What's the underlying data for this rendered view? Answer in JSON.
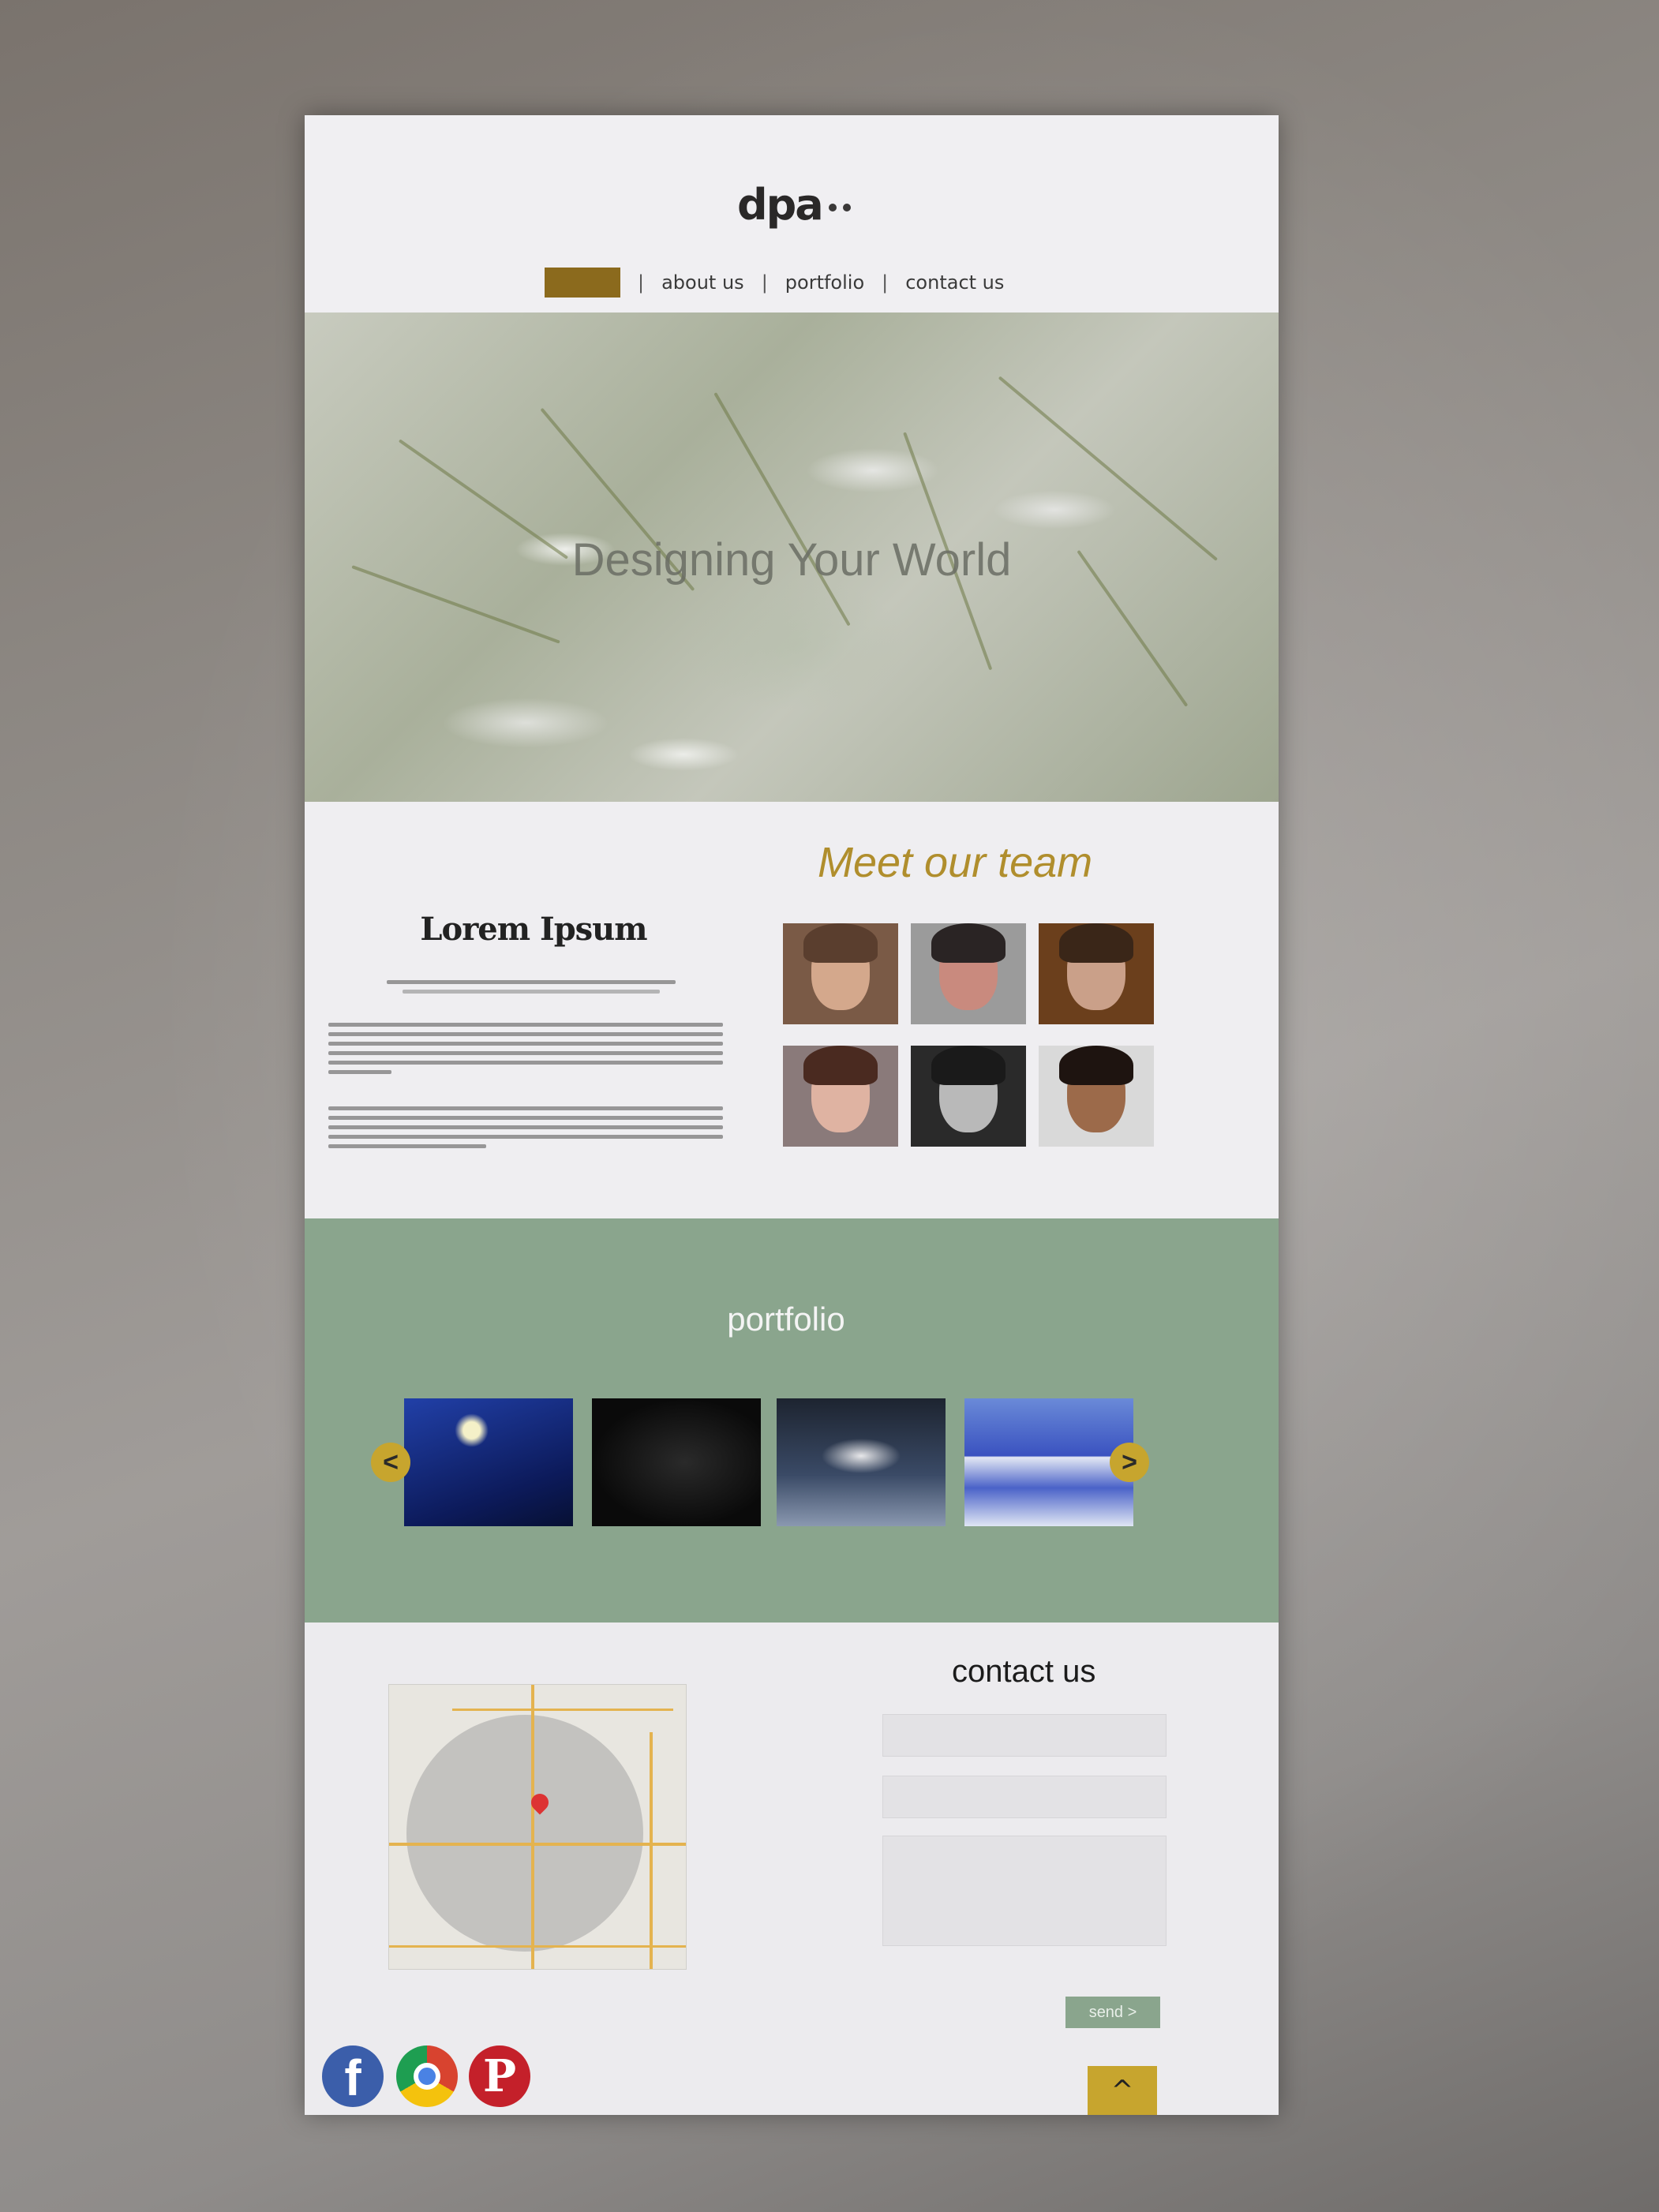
{
  "header": {
    "logo": "dpa",
    "nav": [
      {
        "label": ""
      },
      {
        "label": "about us"
      },
      {
        "label": "portfolio"
      },
      {
        "label": "contact us"
      }
    ]
  },
  "hero": {
    "title": "Designing Your World"
  },
  "team": {
    "heading": "Meet our team",
    "lorem_title": "Lorem Ipsum"
  },
  "portfolio": {
    "heading": "portfolio",
    "prev_label": "<",
    "next_label": ">"
  },
  "contact": {
    "heading": "contact us",
    "send_label": "send >",
    "top_label": "^"
  },
  "colors": {
    "accent_gold": "#c7a52e",
    "nav_active": "#8b6a1d",
    "portfolio_bg": "#8aa58d"
  }
}
